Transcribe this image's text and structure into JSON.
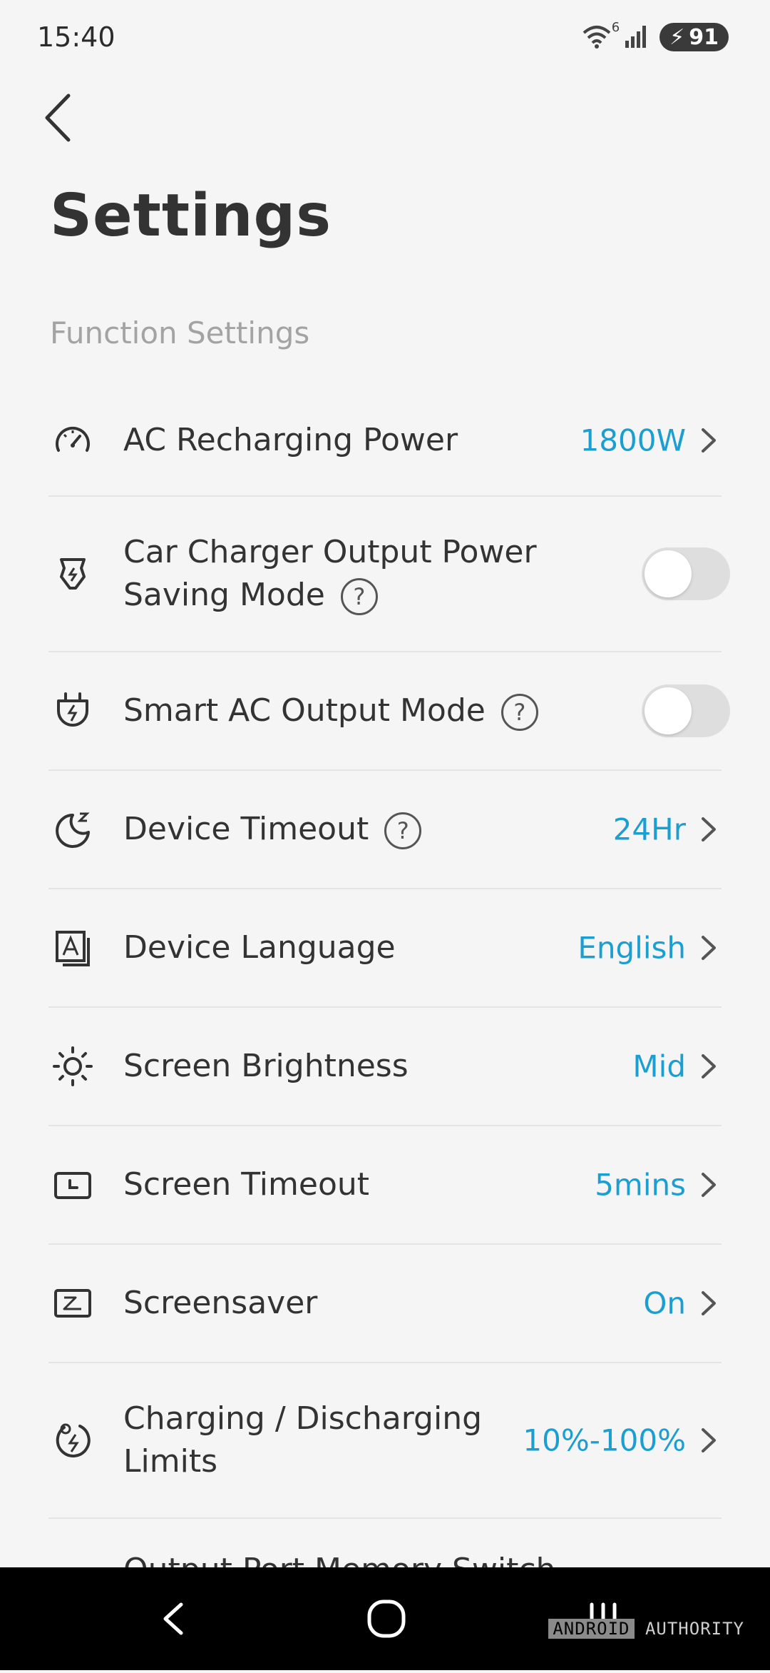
{
  "status": {
    "time": "15:40",
    "battery": "91",
    "wifi_badge": "6"
  },
  "header": {
    "title": "Settings"
  },
  "section": {
    "title": "Function Settings"
  },
  "colors": {
    "accent": "#1a9fd0",
    "text": "#333333",
    "muted": "#a3a3a3",
    "divider": "#e4e4e4"
  },
  "rows": [
    {
      "label": "AC Recharging Power",
      "value": "1800W",
      "icon": "gauge-icon"
    },
    {
      "label_line1": "Car Charger Output Power",
      "label_line2": "Saving Mode",
      "toggle": "off",
      "icon": "car-charger-icon"
    },
    {
      "label": "Smart AC Output Mode",
      "toggle": "off",
      "icon": "plug-bolt-icon"
    },
    {
      "label": "Device Timeout",
      "value": "24Hr",
      "icon": "moon-sleep-icon"
    },
    {
      "label": "Device Language",
      "value": "English",
      "icon": "language-icon"
    },
    {
      "label": "Screen Brightness",
      "value": "Mid",
      "icon": "sun-icon"
    },
    {
      "label": "Screen Timeout",
      "value": "5mins",
      "icon": "screen-timer-icon"
    },
    {
      "label": "Screensaver",
      "value": "On",
      "icon": "screensaver-icon"
    },
    {
      "label_line1": "Charging / Discharging",
      "label_line2": "Limits",
      "value": "10%-100%",
      "icon": "charge-limit-icon"
    },
    {
      "label": "Output Port Memory Switch",
      "toggle": "on"
    }
  ],
  "help_glyph": "?",
  "watermark": {
    "part1": "ANDROID",
    "part2": "AUTHORITY"
  }
}
